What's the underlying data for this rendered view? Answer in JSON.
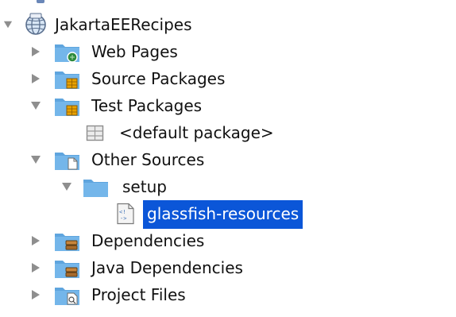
{
  "tree": {
    "root": {
      "label": "JakartaEERecipes",
      "icon": "web-project-globe-icon",
      "expanded": true
    },
    "nodes": [
      {
        "label": "Web Pages",
        "icon": "web-pages-folder-icon",
        "expanded": false
      },
      {
        "label": "Source Packages",
        "icon": "source-packages-folder-icon",
        "expanded": false
      },
      {
        "label": "Test Packages",
        "icon": "test-packages-folder-icon",
        "expanded": true
      },
      {
        "label": "<default package>",
        "icon": "package-icon"
      },
      {
        "label": "Other Sources",
        "icon": "other-sources-folder-icon",
        "expanded": true
      },
      {
        "label": "setup",
        "icon": "folder-icon",
        "expanded": true
      },
      {
        "label": "glassfish-resources",
        "icon": "xml-file-icon",
        "selected": true
      },
      {
        "label": "Dependencies",
        "icon": "dependencies-folder-icon",
        "expanded": false
      },
      {
        "label": "Java Dependencies",
        "icon": "java-dependencies-folder-icon",
        "expanded": false
      },
      {
        "label": "Project Files",
        "icon": "project-files-folder-icon",
        "expanded": false
      }
    ]
  },
  "colors": {
    "selection": "#0b56d8",
    "folder": "#5fa5de",
    "expander": "#8e8e8e"
  }
}
